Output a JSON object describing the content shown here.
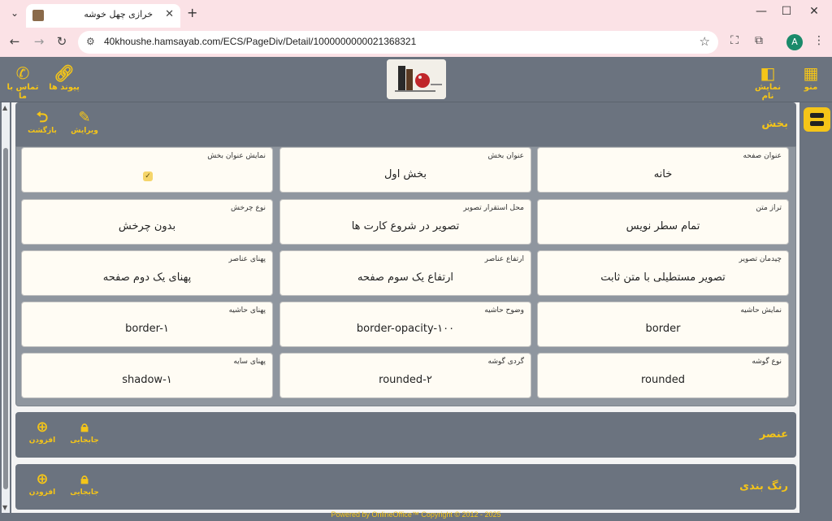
{
  "browser": {
    "tab_title": "خرازی چهل خوشه",
    "url": "40khoushe.hamsayab.com/ECS/PageDiv/Detail/1000000000021368321",
    "profile_initial": "A"
  },
  "header": {
    "menu_label": "منو",
    "show_name_label": "نمایش نام",
    "links_label": "پیوند ها",
    "contact_label": "تماس با ما"
  },
  "section": {
    "title": "بخش",
    "edit_label": "ویرایش",
    "back_label": "بازگشت",
    "fields": [
      {
        "label": "عنوان صفحه",
        "value": "خانه"
      },
      {
        "label": "عنوان بخش",
        "value": "بخش اول"
      },
      {
        "label": "نمایش عنوان بخش",
        "value": ""
      },
      {
        "label": "تراز متن",
        "value": "تمام سطر نویس"
      },
      {
        "label": "محل استقرار تصویر",
        "value": "تصویر در شروع کارت ها"
      },
      {
        "label": "نوع چرخش",
        "value": "بدون چرخش"
      },
      {
        "label": "چیدمان تصویر",
        "value": "تصویر مستطیلی با متن ثابت"
      },
      {
        "label": "ارتفاع عناصر",
        "value": "ارتفاع یک سوم صفحه"
      },
      {
        "label": "پهنای عناصر",
        "value": "پهنای یک دوم صفحه"
      },
      {
        "label": "نمایش حاشیه",
        "value": "border"
      },
      {
        "label": "وضوح حاشیه",
        "value": "border-opacity-۱۰۰"
      },
      {
        "label": "پهنای حاشیه",
        "value": "border-۱"
      },
      {
        "label": "نوع گوشه",
        "value": "rounded"
      },
      {
        "label": "گردی گوشه",
        "value": "rounded-۲"
      },
      {
        "label": "پهنای سایه",
        "value": "shadow-۱"
      }
    ]
  },
  "element_section": {
    "title": "عنصر",
    "move_label": "جابجایی",
    "add_label": "افزودن"
  },
  "color_section": {
    "title": "رنگ بندی",
    "move_label": "جابجایی",
    "add_label": "افزودن"
  },
  "footer": {
    "text": "Powered by OnlineOffice™ Copyright © 2012 - 2025"
  },
  "colors": {
    "accent": "#f5c518",
    "header_bg": "#6b737f",
    "card_bg": "#fffcf4"
  }
}
